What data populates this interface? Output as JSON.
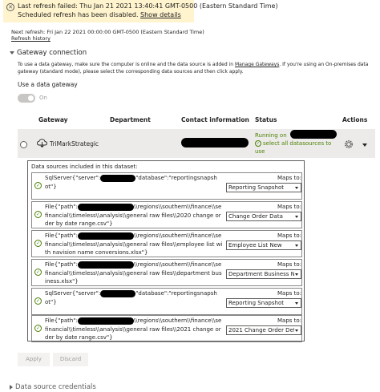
{
  "banner": {
    "line1": "Last refresh failed: Thu Jan 21 2021 13:40:41 GMT-0500 (Eastern Standard Time)",
    "line2": "Scheduled refresh has been disabled.",
    "link": "Show details",
    "bg_color": "#fff4ce"
  },
  "next_refresh": "Next refresh: Fri Jan 22 2021 00:00:00 GMT-0500 (Eastern Standard Time)",
  "refresh_history": "Refresh history",
  "gateway_section": {
    "title": "Gateway connection",
    "desc_pre": "To use a data gateway, make sure the computer is online and the data source is added in ",
    "desc_link": "Manage Gateways",
    "desc_post": ". If you're using an On-premises data gateway (standard mode), please select the corresponding data sources and then click apply.",
    "use_gateway_label": "Use a data gateway",
    "toggle_label": "On"
  },
  "table": {
    "headers": {
      "gateway": "Gateway",
      "department": "Department",
      "contact": "Contact information",
      "status": "Status",
      "actions": "Actions"
    },
    "row": {
      "name": "TriMarkStrategic",
      "status_l1": "Running on",
      "status_l2": "select all datasources to use",
      "status_color": "#498205"
    }
  },
  "datasources": {
    "title": "Data sources included in this dataset:",
    "maps_to": "Maps to:",
    "items": [
      {
        "l1a": "SqlServer{\"server\":",
        "l1b": "\"database\":\"reportingsnapsh",
        "l2": "ot\"}",
        "value": "Reporting Snapshot"
      },
      {
        "l1a": "File{\"path\":",
        "l1b": "\\\\regions\\\\southern\\\\finance\\\\se",
        "l2": "financial\\\\timeless\\\\analysis\\\\general raw files\\\\2020 change or",
        "l3": "der by date range.csv\"}",
        "value": "Change Order Data"
      },
      {
        "l1a": "File{\"path\":",
        "l1b": "\\\\regions\\\\southern\\\\finance\\\\se",
        "l2": "financial\\\\timeless\\\\analysis\\\\general raw files\\\\employee list wi",
        "l3": "th navision name conversions.xlsx\"}",
        "value": "Employee List New"
      },
      {
        "l1a": "File{\"path\":",
        "l1b": "\\\\regions\\\\southern\\\\finance\\\\se",
        "l2": "financial\\\\timeless\\\\analysis\\\\general raw files\\\\department bus",
        "l3": "iness.xlsx\"}",
        "value": "Department Business N"
      },
      {
        "l1a": "SqlServer{\"server\":",
        "l1b": "\"database\":\"reportingsnapsh",
        "l2": "ot\"}",
        "value": "Reporting Snapshot"
      },
      {
        "l1a": "File{\"path\":",
        "l1b": "\\\\regions\\\\southern\\\\finance\\\\se",
        "l2": "financial\\\\timeless\\\\analysis\\\\general raw files\\\\2021 change or",
        "l3": "der by date range.csv\"}",
        "value": "2021 Change Order Det"
      }
    ]
  },
  "buttons": {
    "apply": "Apply",
    "discard": "Discard"
  },
  "section2": "Data source credentials"
}
